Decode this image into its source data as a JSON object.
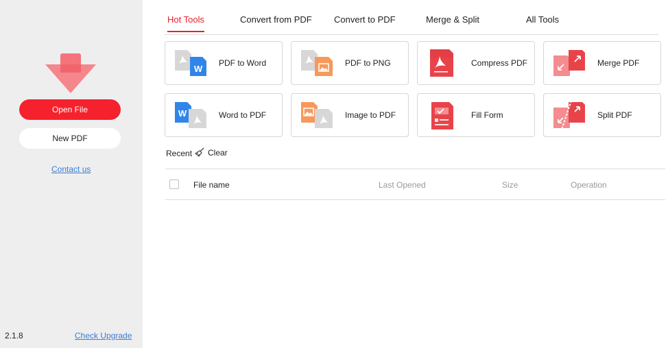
{
  "sidebar": {
    "open_file": "Open File",
    "new_pdf": "New PDF",
    "contact": "Contact us",
    "version": "2.1.8",
    "check_upgrade": "Check Upgrade"
  },
  "tabs": [
    {
      "label": "Hot Tools",
      "active": true
    },
    {
      "label": "Convert from PDF",
      "active": false
    },
    {
      "label": "Convert to PDF",
      "active": false
    },
    {
      "label": "Merge & Split",
      "active": false
    },
    {
      "label": "All Tools",
      "active": false
    }
  ],
  "tools": [
    {
      "label": "PDF to Word",
      "icon": "pdf-to-word-icon"
    },
    {
      "label": "PDF to PNG",
      "icon": "pdf-to-png-icon"
    },
    {
      "label": "Compress PDF",
      "icon": "compress-pdf-icon"
    },
    {
      "label": "Merge PDF",
      "icon": "merge-pdf-icon"
    },
    {
      "label": "Word to PDF",
      "icon": "word-to-pdf-icon"
    },
    {
      "label": "Image to PDF",
      "icon": "image-to-pdf-icon"
    },
    {
      "label": "Fill Form",
      "icon": "fill-form-icon"
    },
    {
      "label": "Split PDF",
      "icon": "split-pdf-icon"
    }
  ],
  "recent": {
    "title": "Recent",
    "clear": "Clear",
    "columns": {
      "file_name": "File name",
      "last_opened": "Last Opened",
      "size": "Size",
      "operation": "Operation"
    }
  },
  "colors": {
    "accent": "#f5222d",
    "sidebar_bg": "#eeeeef",
    "link": "#3a7bd5"
  }
}
